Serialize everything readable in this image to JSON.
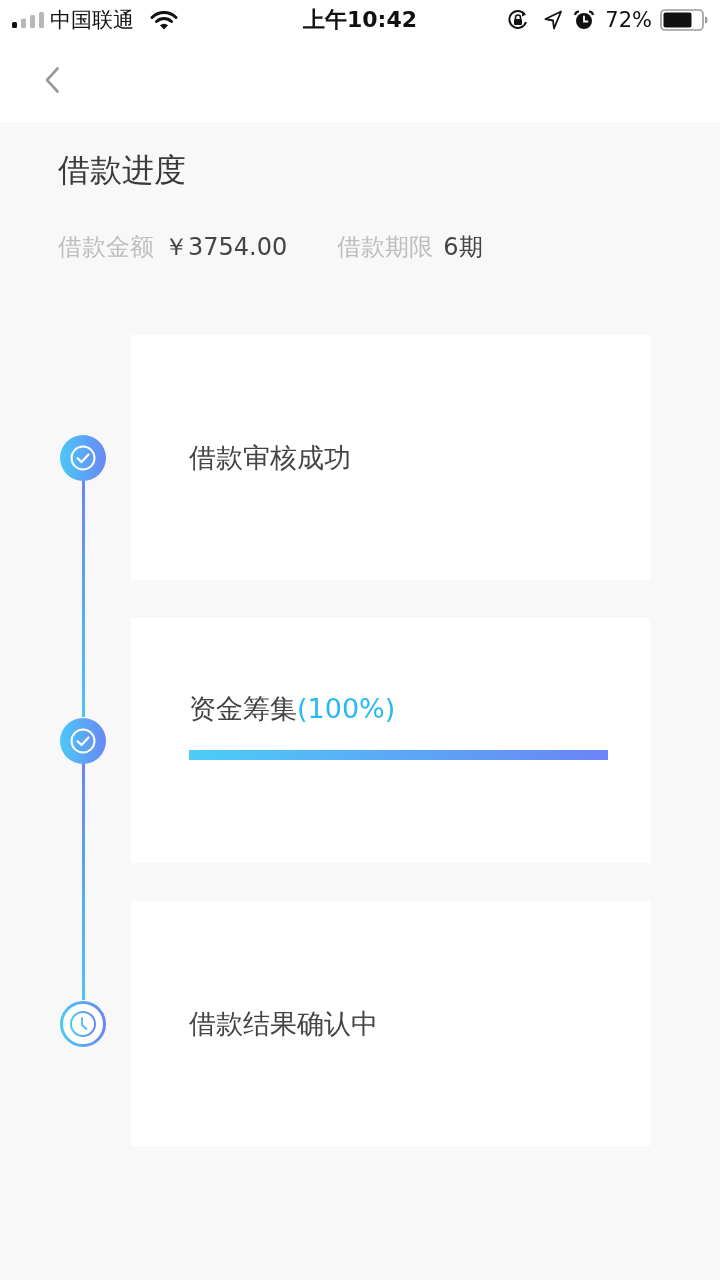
{
  "status_bar": {
    "carrier": "中国联通",
    "time": "上午10:42",
    "battery": "72%"
  },
  "title": "借款进度",
  "summary": [
    {
      "label": "借款金额",
      "value": "￥3754.00"
    },
    {
      "label": "借款期限",
      "value": "6期"
    }
  ],
  "steps": [
    {
      "label": "借款审核成功",
      "done": true
    },
    {
      "label": "资金筹集",
      "reading": "(100%)",
      "level": 1,
      "done": true
    },
    {
      "label": "借款结果确认中",
      "done": false
    }
  ]
}
